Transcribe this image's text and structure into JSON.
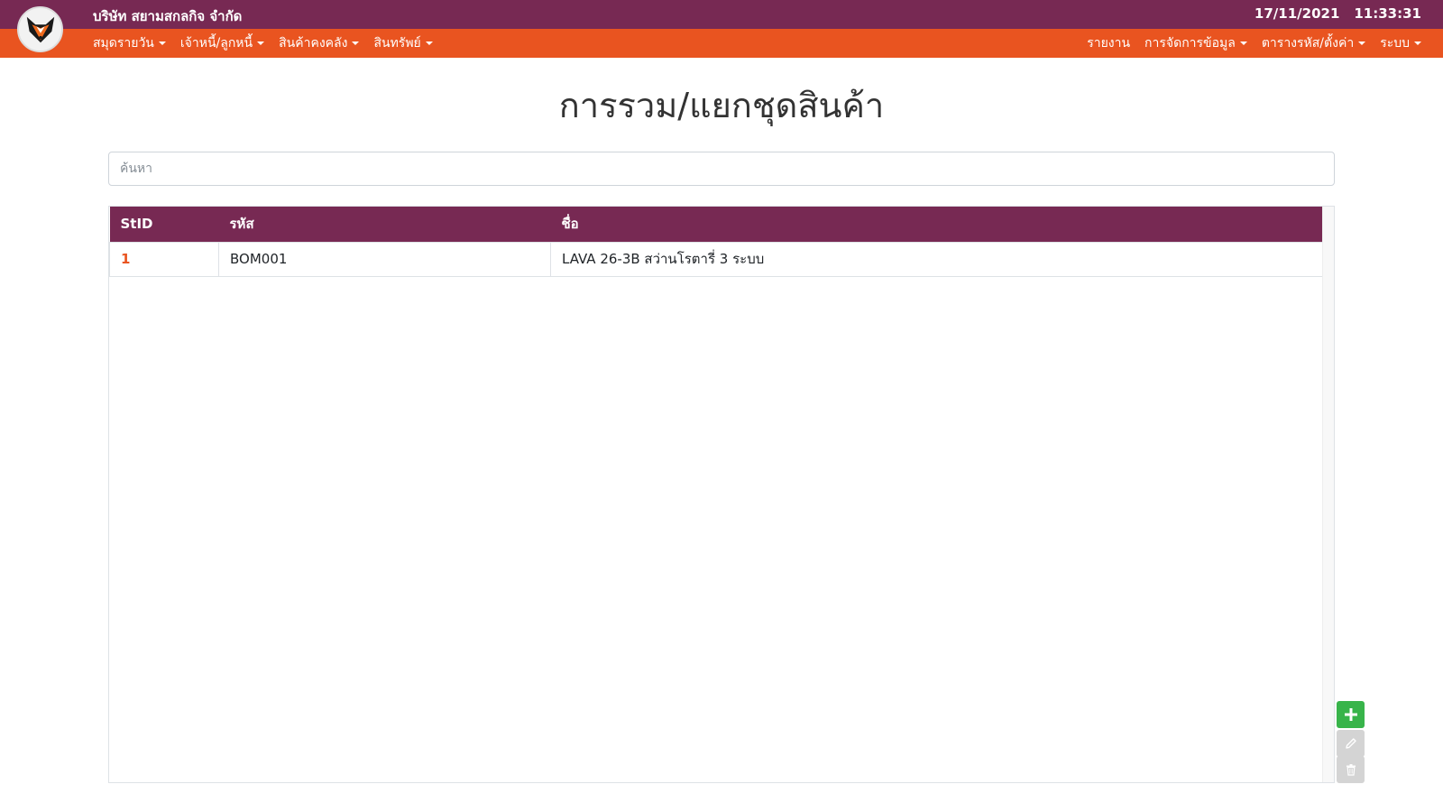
{
  "header": {
    "company_name": "บริษัท สยามสกลกิจ จำกัด",
    "date": "17/11/2021",
    "time": "11:33:31"
  },
  "logo": {
    "icon": "fox-logo-icon"
  },
  "menu": {
    "left": [
      {
        "label": "สมุดรายวัน",
        "dropdown": true
      },
      {
        "label": "เจ้าหนี้/ลูกหนี้",
        "dropdown": true
      },
      {
        "label": "สินค้าคงคลัง",
        "dropdown": true
      },
      {
        "label": "สินทรัพย์",
        "dropdown": true
      }
    ],
    "right": [
      {
        "label": "รายงาน",
        "dropdown": false
      },
      {
        "label": "การจัดการข้อมูล",
        "dropdown": true
      },
      {
        "label": "ตารางรหัส/ตั้งค่า",
        "dropdown": true
      },
      {
        "label": "ระบบ",
        "dropdown": true
      }
    ]
  },
  "page": {
    "title": "การรวม/แยกชุดสินค้า",
    "search_placeholder": "ค้นหา"
  },
  "table": {
    "columns": [
      "StID",
      "รหัส",
      "ชื่อ"
    ],
    "rows": [
      {
        "stid": "1",
        "code": "BOM001",
        "name": "LAVA 26-3B สว่านโรตารี่ 3 ระบบ"
      }
    ]
  },
  "actions": {
    "add_icon": "plus-icon",
    "edit_icon": "pencil-icon",
    "delete_icon": "trash-icon"
  },
  "colors": {
    "header_purple": "#772953",
    "menu_orange": "#e95420",
    "add_green": "#38b44a",
    "disabled_gray": "#d4d4d4"
  }
}
